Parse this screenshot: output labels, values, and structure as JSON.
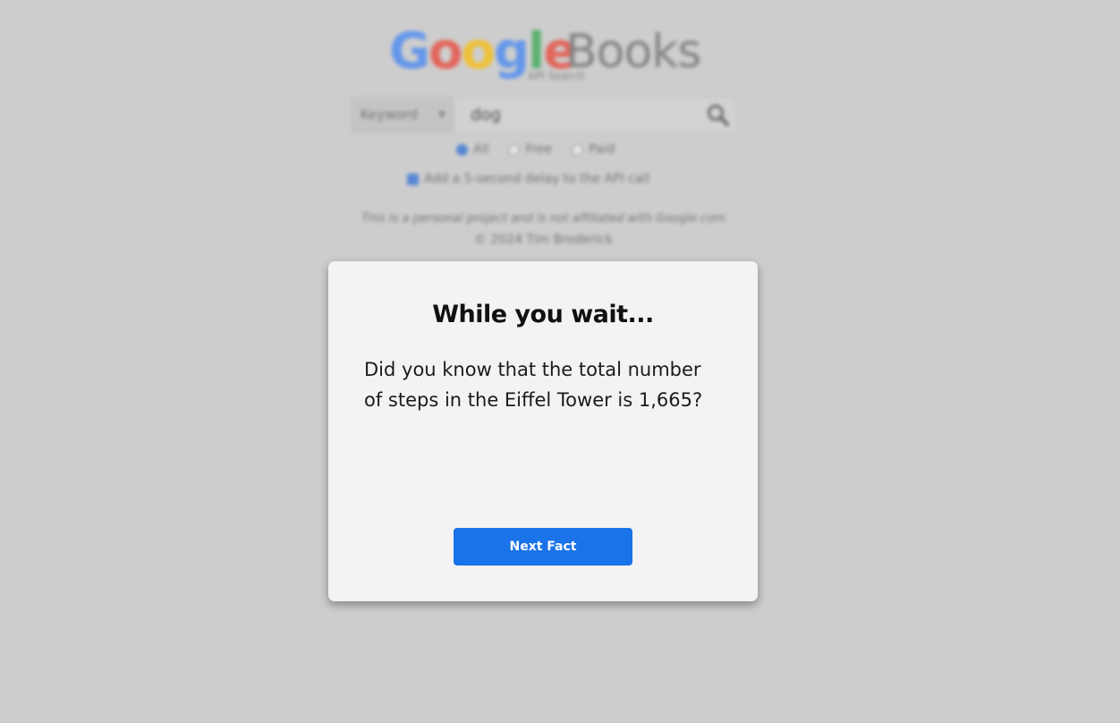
{
  "colors": {
    "google_blue": "#4285F4",
    "google_red": "#EA4335",
    "google_yellow": "#FBBC05",
    "google_green": "#34A853",
    "button_blue": "#1a73e8"
  },
  "header": {
    "logo_letters": [
      "G",
      "o",
      "o",
      "g",
      "l",
      "e"
    ],
    "logo_books": "Books",
    "logo_subtitle": "API Search"
  },
  "search": {
    "type_selected": "Keyword",
    "query": "dog",
    "icon": "search-icon"
  },
  "filters": {
    "options": [
      "All",
      "Free",
      "Paid"
    ],
    "selected": "All"
  },
  "delay_option": {
    "label": "Add a 5-second delay to the API call",
    "checked": true
  },
  "footer": {
    "disclaimer": "This is a personal project and is not affiliated with Google.com",
    "copyright": "© 2024 Tim Broderick"
  },
  "modal": {
    "title": "While you wait...",
    "fact": "Did you know that the total number of steps in the Eiffel Tower is 1,665?",
    "next_button": "Next Fact"
  }
}
